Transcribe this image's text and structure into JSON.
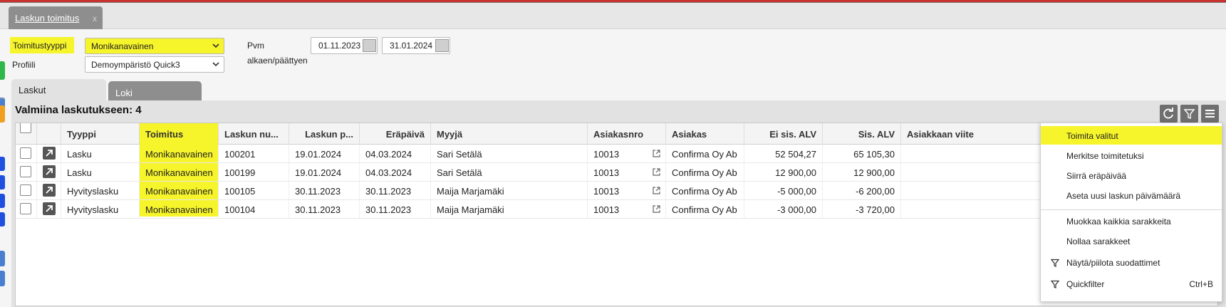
{
  "doc_tab": {
    "label": "Laskun toimitus",
    "close": "x"
  },
  "filters": {
    "delivery_type_label": "Toimitustyyppi",
    "delivery_type_value": "Monikanavainen",
    "profile_label": "Profiili",
    "profile_value": "Demoympäristö Quick3",
    "date_label_1": "Pvm",
    "date_label_2": "alkaen/päättyen",
    "date_from": "01.11.2023",
    "date_to": "31.01.2024"
  },
  "subtabs": {
    "invoices": "Laskut",
    "log": "Loki"
  },
  "summary": "Valmiina laskutukseen: 4",
  "columns": {
    "type": "Tyyppi",
    "delivery": "Toimitus",
    "invoice_no": "Laskun nu...",
    "invoice_date": "Laskun p...",
    "due_date": "Eräpäivä",
    "seller": "Myyjä",
    "customer_no": "Asiakasnro",
    "customer": "Asiakas",
    "net": "Ei sis. ALV",
    "gross": "Sis. ALV",
    "reference": "Asiakkaan viite"
  },
  "rows": [
    {
      "type": "Lasku",
      "delivery": "Monikanavainen",
      "invoice_no": "100201",
      "invoice_date": "19.01.2024",
      "due_date": "04.03.2024",
      "seller": "Sari Setälä",
      "customer_no": "10013",
      "customer": "Confirma Oy Ab",
      "net": "52 504,27",
      "gross": "65 105,30"
    },
    {
      "type": "Lasku",
      "delivery": "Monikanavainen",
      "invoice_no": "100199",
      "invoice_date": "19.01.2024",
      "due_date": "04.03.2024",
      "seller": "Sari Setälä",
      "customer_no": "10013",
      "customer": "Confirma Oy Ab",
      "net": "12 900,00",
      "gross": "12 900,00"
    },
    {
      "type": "Hyvityslasku",
      "delivery": "Monikanavainen",
      "invoice_no": "100105",
      "invoice_date": "30.11.2023",
      "due_date": "30.11.2023",
      "seller": "Maija Marjamäki",
      "customer_no": "10013",
      "customer": "Confirma Oy Ab",
      "net": "-5 000,00",
      "gross": "-6 200,00"
    },
    {
      "type": "Hyvityslasku",
      "delivery": "Monikanavainen",
      "invoice_no": "100104",
      "invoice_date": "30.11.2023",
      "due_date": "30.11.2023",
      "seller": "Maija Marjamäki",
      "customer_no": "10013",
      "customer": "Confirma Oy Ab",
      "net": "-3 000,00",
      "gross": "-3 720,00"
    }
  ],
  "menu": {
    "deliver_selected": "Toimita valitut",
    "mark_delivered": "Merkitse toimitetuksi",
    "move_due_date": "Siirrä eräpäivää",
    "set_invoice_date": "Aseta uusi laskun päivämäärä",
    "edit_all_columns": "Muokkaa kaikkia sarakkeita",
    "reset_columns": "Nollaa sarakkeet",
    "toggle_filters": "Näytä/piilota suodattimet",
    "quickfilter": "Quickfilter",
    "quickfilter_shortcut": "Ctrl+B"
  },
  "colors": {
    "highlight": "#f6f42a",
    "tab_inactive": "#8e8e8e",
    "top_accent": "#c8332f"
  }
}
